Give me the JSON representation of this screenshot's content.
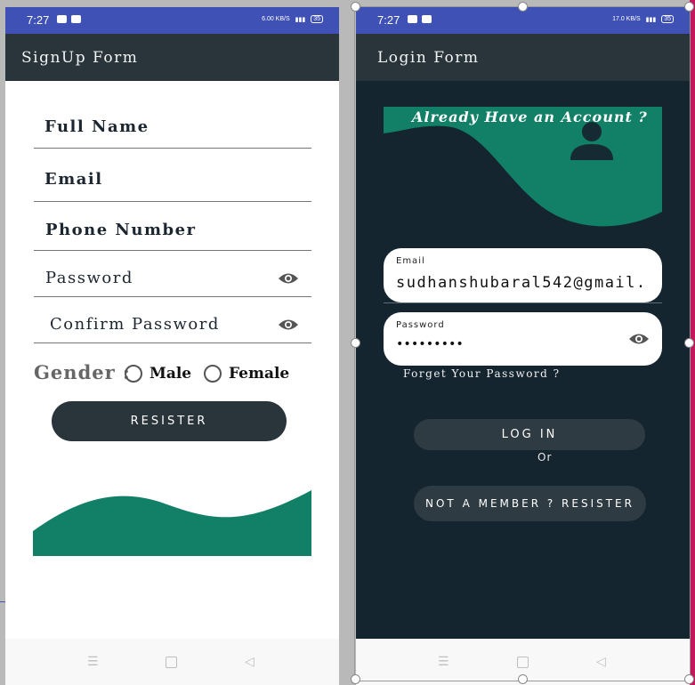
{
  "signup": {
    "status": {
      "time": "7:27",
      "speed": "6.00 KB/S",
      "battery": "35"
    },
    "appbar_title": "SignUp Form",
    "fields": {
      "full_name": "Full Name",
      "email": "Email",
      "phone": "Phone Number",
      "password": "Password",
      "confirm_password": "Confirm Password"
    },
    "gender_label": "Gender :",
    "male_label": "Male",
    "female_label": "Female",
    "register_button": "RESISTER",
    "accent_color": "#127f67"
  },
  "login": {
    "status": {
      "time": "7:27",
      "speed": "17.0 KB/S",
      "battery": "35"
    },
    "appbar_title": "Login Form",
    "banner_title": "Already Have an Account ?",
    "email_label": "Email",
    "email_value": "sudhanshubaral542@gmail.",
    "password_label": "Password",
    "password_value": "•••••••••",
    "forgot_password": "Forget Your Password ?",
    "login_button": "LOG IN",
    "or_text": "Or",
    "register_button": "NOT A MEMBER ? RESISTER",
    "background_color": "#152530",
    "accent_color": "#127f67"
  },
  "icons": {
    "visibility": "eye-icon",
    "avatar": "person-icon",
    "nav_menu": "menu-icon",
    "nav_home": "square-icon",
    "nav_back": "back-icon"
  }
}
